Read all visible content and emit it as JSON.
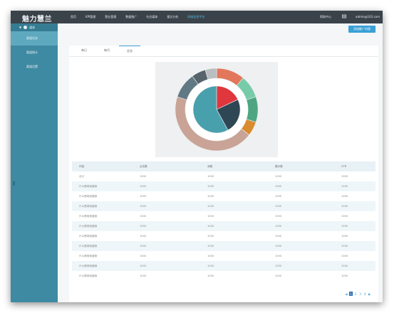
{
  "topbar": {
    "logo": "魅力慧兰",
    "nav": [
      "首页",
      "KPI管理",
      "营业管理",
      "数据推广",
      "社交媒体",
      "报文分析",
      "网络信息平台"
    ],
    "active_index": 6,
    "help": "帮助中心",
    "user": "admin@163.com"
  },
  "sidebar": {
    "section": "媒体",
    "items": [
      "渠道任务",
      "渠道统计",
      "渠道设置"
    ],
    "active_index": 0
  },
  "content": {
    "add_button": "添加推广内容",
    "tabs": [
      "每日",
      "每月",
      "总览"
    ],
    "active_tab": 2
  },
  "chart_data": {
    "type": "pie",
    "inner": {
      "labels": [
        "红",
        "深蓝一",
        "青蓝"
      ],
      "values": [
        18,
        24,
        58
      ],
      "colors": [
        "#e0363e",
        "#2f4654",
        "#48a0ad"
      ]
    },
    "outer": {
      "labels": [
        "橙红",
        "浅绿一",
        "绿一",
        "橙",
        "粉棕",
        "灰蓝",
        "深灰",
        "浅灰"
      ],
      "values": [
        10,
        8,
        9,
        5,
        40,
        9,
        5,
        4
      ],
      "colors": [
        "#e2775c",
        "#77cba9",
        "#4ea681",
        "#d98b2f",
        "#c8a396",
        "#617984",
        "#57636a",
        "#b9bec1"
      ]
    }
  },
  "table": {
    "headers": [
      "内容",
      "点击数",
      "消费",
      "展示数",
      "CTR"
    ],
    "rows": [
      [
        "合计",
        "1000",
        "1000",
        "1000",
        "1000"
      ],
      [
        "什么是网络营销",
        "1000",
        "1000",
        "1000",
        "1000"
      ],
      [
        "什么是网络营销",
        "1000",
        "1000",
        "1000",
        "1000"
      ],
      [
        "什么是网络营销",
        "1000",
        "1000",
        "1000",
        "1000"
      ],
      [
        "什么是网络营销",
        "1000",
        "1000",
        "1000",
        "1000"
      ],
      [
        "什么是网络营销",
        "1000",
        "1000",
        "1000",
        "1000"
      ],
      [
        "什么是网络营销",
        "1000",
        "1000",
        "1000",
        "1000"
      ],
      [
        "什么是网络营销",
        "1000",
        "1000",
        "1000",
        "1000"
      ],
      [
        "什么是网络营销",
        "1000",
        "1000",
        "1000",
        "1000"
      ],
      [
        "什么是网络营销",
        "1000",
        "1000",
        "1000",
        "1000"
      ],
      [
        "什么是网络营销",
        "1000",
        "1000",
        "1000",
        "1000"
      ]
    ]
  },
  "pager": {
    "pages": [
      "1",
      "2",
      "3",
      "4"
    ],
    "prev": "◀",
    "next": "▶",
    "current": 0
  }
}
